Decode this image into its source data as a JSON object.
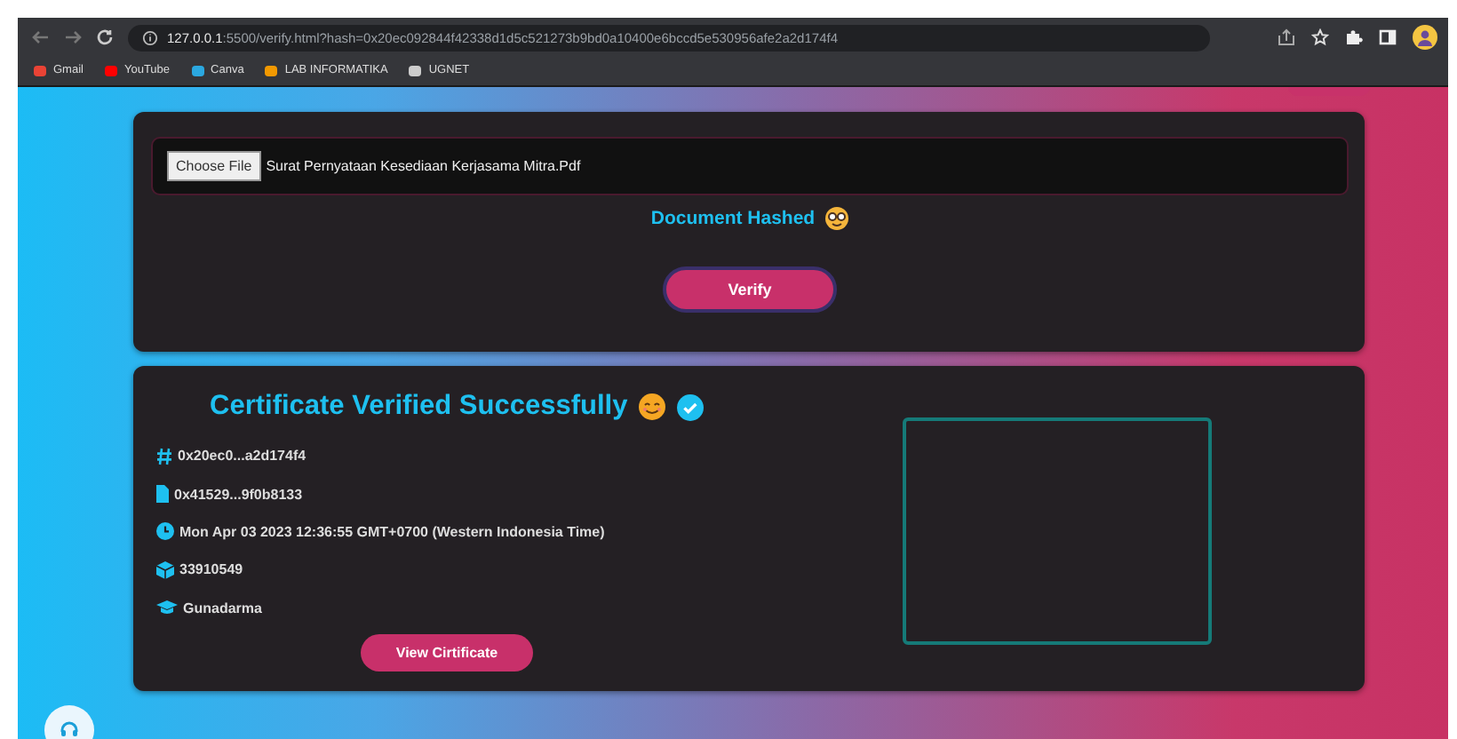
{
  "browser": {
    "url_host": "127.0.0.1",
    "url_rest": ":5500/verify.html?hash=0x20ec092844f42338d1d5c521273b9bd0a10400e6bccd5e530956afe2a2d174f4",
    "bookmarks": [
      {
        "label": "Gmail",
        "color": "#ea4335"
      },
      {
        "label": "YouTube",
        "color": "#ff0000"
      },
      {
        "label": "Canva",
        "color": "#2ba8e0"
      },
      {
        "label": "LAB INFORMATIKA",
        "color": "#f29900"
      },
      {
        "label": "UGNET",
        "color": "#cccccc"
      }
    ]
  },
  "upload": {
    "button": "Choose File",
    "file_name": "Surat Pernyataan Kesediaan Kerjasama Mitra.Pdf",
    "status": "Document Hashed",
    "verify_button": "Verify"
  },
  "certificate": {
    "title": "Certificate Verified Successfully",
    "details": [
      {
        "kind": "hash",
        "text": "0x20ec0...a2d174f4"
      },
      {
        "kind": "file",
        "text": "0x41529...9f0b8133"
      },
      {
        "kind": "time",
        "text": "Mon Apr 03 2023 12:36:55 GMT+0700 (Western Indonesia Time)"
      },
      {
        "kind": "block",
        "text": "33910549"
      },
      {
        "kind": "school",
        "text": "Gunadarma"
      }
    ],
    "view_button": "View Cirtificate"
  }
}
